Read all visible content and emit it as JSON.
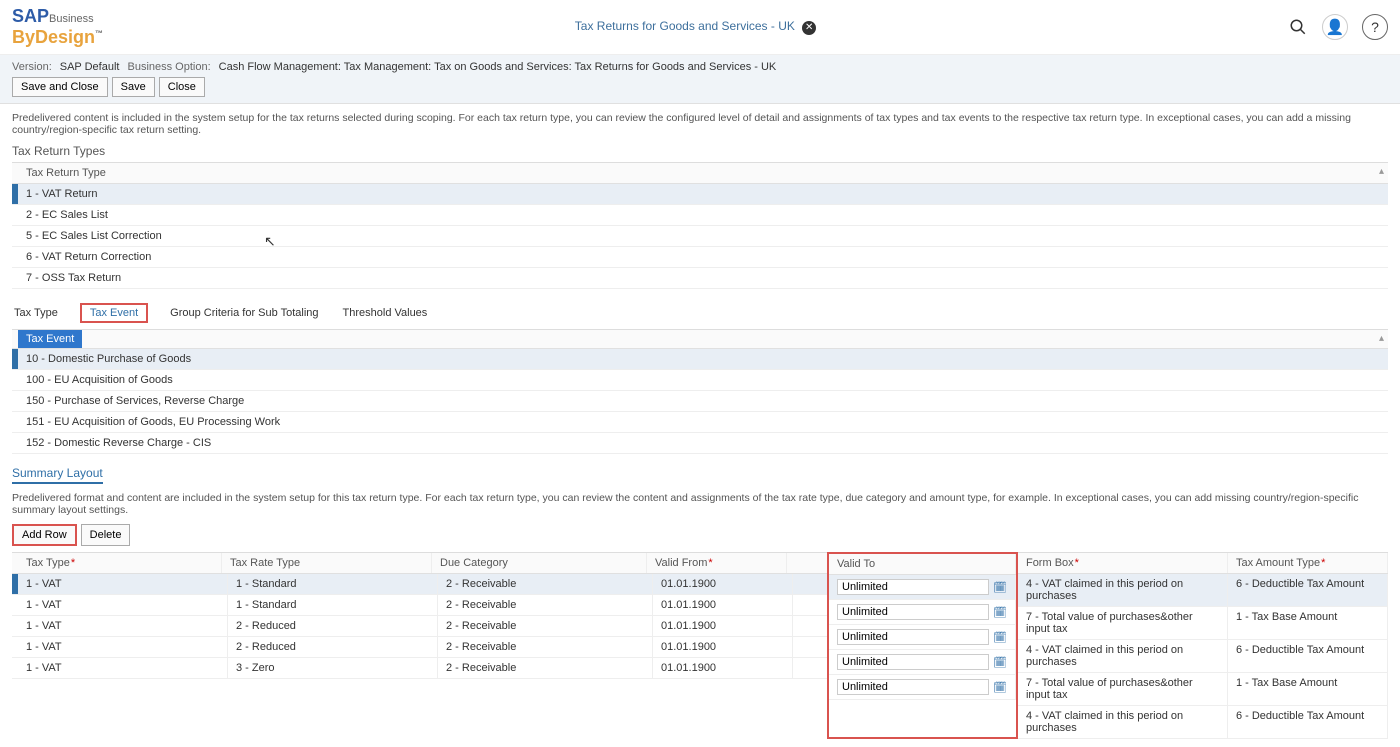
{
  "header": {
    "logo_sap": "SAP",
    "logo_business": "Business",
    "logo_bydesign": "ByDesign",
    "title": "Tax Returns for Goods and Services - UK"
  },
  "meta": {
    "version_label": "Version:",
    "version_value": "SAP Default",
    "option_label": "Business Option:",
    "option_value": "Cash Flow Management: Tax Management: Tax on Goods and Services: Tax Returns for Goods and Services - UK",
    "save_close": "Save and Close",
    "save": "Save",
    "close": "Close"
  },
  "desc1": "Predelivered content is included in the system setup for the tax returns selected during scoping. For each tax return type, you can review the configured level of detail and assignments of tax types and tax events to the respective tax return type. In exceptional cases, you can add a missing country/region-specific tax return setting.",
  "section_types": "Tax Return Types",
  "types_header": "Tax Return Type",
  "types": [
    "1 - VAT Return",
    "2 - EC Sales List",
    "5 - EC Sales List Correction",
    "6 - VAT Return Correction",
    "7 - OSS Tax Return"
  ],
  "tabs": {
    "tax_type": "Tax Type",
    "tax_event": "Tax Event",
    "group_crit": "Group Criteria for Sub Totaling",
    "threshold": "Threshold Values"
  },
  "event_header": "Tax Event",
  "events": [
    "10 - Domestic Purchase of Goods",
    "100 - EU Acquisition of Goods",
    "150 - Purchase of Services, Reverse Charge",
    "151 - EU Acquisition of Goods, EU Processing Work",
    "152 - Domestic Reverse Charge - CIS"
  ],
  "summary_title": "Summary Layout",
  "desc2": "Predelivered format and content are included in the system setup for this tax return type. For each tax return type, you can review the content and assignments of the tax rate type, due category and amount type, for example. In exceptional cases, you can add missing country/region-specific summary layout settings.",
  "btn_addrow": "Add Row",
  "btn_delete": "Delete",
  "cols": {
    "tax_type": "Tax Type",
    "rate_type": "Tax Rate Type",
    "due_cat": "Due Category",
    "valid_from": "Valid From",
    "valid_to": "Valid To",
    "form_box": "Form Box",
    "tax_amount_type": "Tax Amount Type"
  },
  "rows": [
    {
      "tt": "1 - VAT",
      "rt": "1 - Standard",
      "dc": "2 - Receivable",
      "vf": "01.01.1900",
      "vt": "Unlimited",
      "fb": "4 - VAT claimed in this period on purchases",
      "ta": "6 - Deductible Tax Amount"
    },
    {
      "tt": "1 - VAT",
      "rt": "1 - Standard",
      "dc": "2 - Receivable",
      "vf": "01.01.1900",
      "vt": "Unlimited",
      "fb": "7 - Total value of purchases&other input tax",
      "ta": "1 - Tax Base Amount"
    },
    {
      "tt": "1 - VAT",
      "rt": "2 - Reduced",
      "dc": "2 - Receivable",
      "vf": "01.01.1900",
      "vt": "Unlimited",
      "fb": "4 - VAT claimed in this period on purchases",
      "ta": "6 - Deductible Tax Amount"
    },
    {
      "tt": "1 - VAT",
      "rt": "2 - Reduced",
      "dc": "2 - Receivable",
      "vf": "01.01.1900",
      "vt": "Unlimited",
      "fb": "7 - Total value of purchases&other input tax",
      "ta": "1 - Tax Base Amount"
    },
    {
      "tt": "1 - VAT",
      "rt": "3 - Zero",
      "dc": "2 - Receivable",
      "vf": "01.01.1900",
      "vt": "Unlimited",
      "fb": "4 - VAT claimed in this period on purchases",
      "ta": "6 - Deductible Tax Amount"
    }
  ]
}
